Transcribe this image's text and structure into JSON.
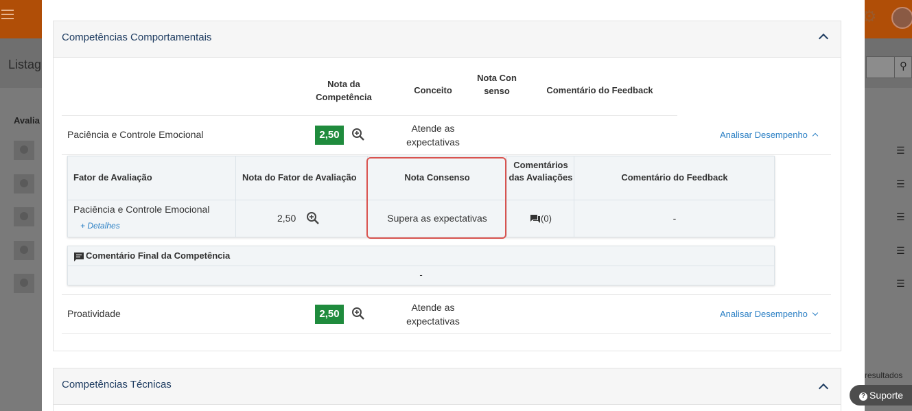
{
  "background": {
    "listing_title": "Listag",
    "column_label": "Avalia",
    "results_text": "resultados",
    "support_label": "Suporte"
  },
  "behavioral": {
    "title": "Competências Comportamentais",
    "headers": {
      "nota_competencia": "Nota da Competência",
      "conceito": "Conceito",
      "nota_consenso": "Nota Consenso",
      "comentario_feedback": "Comentário do Feedback"
    },
    "competencies": [
      {
        "name": "Paciência e Controle Emocional",
        "score": "2,50",
        "concept": "Atende as expectativas",
        "action": "Analisar Desempenho"
      },
      {
        "name": "Proatividade",
        "score": "2,50",
        "concept": "Atende as expectativas",
        "action": "Analisar Desempenho"
      }
    ],
    "factor_table": {
      "headers": {
        "fator": "Fator de Avaliação",
        "nota_fator": "Nota do Fator de Avaliação",
        "nota_consenso": "Nota Consenso",
        "comentarios_avaliacoes": "Comentários das Avaliações",
        "comentario_feedback": "Comentário do Feedback"
      },
      "row": {
        "fator": "Paciência e Controle Emocional",
        "details_link": "+ Detalhes",
        "nota_fator": "2,50",
        "nota_consenso": "Supera as expectativas",
        "comments_count": "(0)",
        "feedback": "-"
      }
    },
    "final_comment": {
      "title": "Comentário Final da Competência",
      "value": "-"
    }
  },
  "technical": {
    "title": "Competências Técnicas"
  },
  "colors": {
    "brand_orange": "#b04e07",
    "score_green": "#1f8b3d",
    "link_blue": "#2a7fc4",
    "highlight_red": "#d9534f",
    "title_navy": "#1d3b60"
  }
}
